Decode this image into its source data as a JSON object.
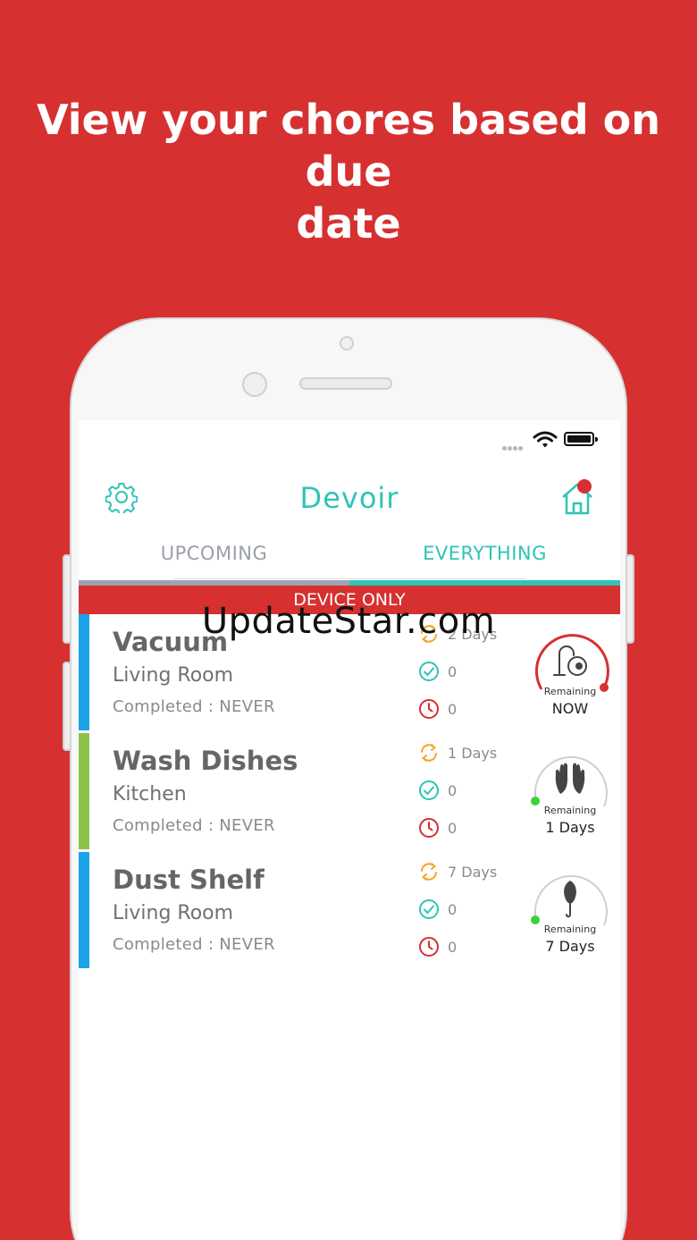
{
  "headline": {
    "line1": "View your chores based on due",
    "line2": "date"
  },
  "app": {
    "title": "Devoir"
  },
  "tabs": [
    {
      "label": "UPCOMING",
      "active": false
    },
    {
      "label": "EVERYTHING",
      "active": true
    }
  ],
  "banner": "DEVICE ONLY",
  "watermark": "UpdateStar.com",
  "colors": {
    "brand_red": "#d63031",
    "teal": "#2ec4b6",
    "blue_bar": "#1aa3e8",
    "green_bar": "#8bc34a",
    "orange": "#f5a623"
  },
  "chores": [
    {
      "name": "Vacuum",
      "room": "Living Room",
      "completed": "Completed : NEVER",
      "frequency": "2 Days",
      "done_count": "0",
      "missed_count": "0",
      "remaining_label": "Remaining",
      "remaining_value": "NOW",
      "icon": "vacuum-icon",
      "bar_color": "#1aa3e8",
      "ring_color": "#d63031"
    },
    {
      "name": "Wash Dishes",
      "room": "Kitchen",
      "completed": "Completed : NEVER",
      "frequency": "1 Days",
      "done_count": "0",
      "missed_count": "0",
      "remaining_label": "Remaining",
      "remaining_value": "1 Days",
      "icon": "gloves-icon",
      "bar_color": "#8bc34a",
      "ring_color": "#cfcfcf"
    },
    {
      "name": "Dust Shelf",
      "room": "Living Room",
      "completed": "Completed : NEVER",
      "frequency": "7 Days",
      "done_count": "0",
      "missed_count": "0",
      "remaining_label": "Remaining",
      "remaining_value": "7 Days",
      "icon": "duster-icon",
      "bar_color": "#1aa3e8",
      "ring_color": "#cfcfcf"
    }
  ]
}
